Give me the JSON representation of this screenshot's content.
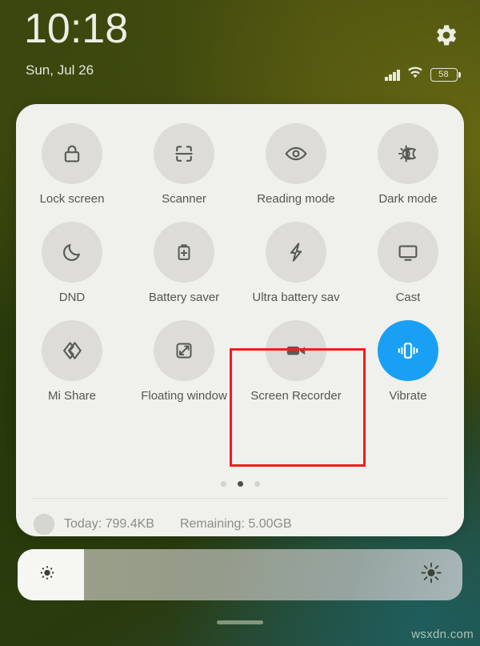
{
  "status_bar": {
    "time": "10:18",
    "date": "Sun, Jul 26",
    "battery_percent": "58",
    "settings_icon": "gear-icon",
    "signal_icon": "cellular-signal-icon",
    "wifi_icon": "wifi-icon",
    "battery_icon": "battery-icon"
  },
  "quick_settings": {
    "toggles": [
      {
        "label": "Lock screen",
        "icon": "lock-icon",
        "active": false
      },
      {
        "label": "Scanner",
        "icon": "scanner-icon",
        "active": false
      },
      {
        "label": "Reading mode",
        "icon": "eye-icon",
        "active": false
      },
      {
        "label": "Dark mode",
        "icon": "sun-moon-icon",
        "active": false
      },
      {
        "label": "DND",
        "icon": "moon-icon",
        "active": false
      },
      {
        "label": "Battery saver",
        "icon": "battery-plus-icon",
        "active": false
      },
      {
        "label": "Ultra battery sav",
        "icon": "lightning-bolt-icon",
        "active": false
      },
      {
        "label": "Cast",
        "icon": "monitor-icon",
        "active": false
      },
      {
        "label": "Mi Share",
        "icon": "mi-share-icon",
        "active": false
      },
      {
        "label": "Floating window",
        "icon": "floating-window-icon",
        "active": false
      },
      {
        "label": "Screen Recorder",
        "icon": "video-camera-icon",
        "active": false
      },
      {
        "label": "Vibrate",
        "icon": "vibrate-icon",
        "active": true
      }
    ],
    "pages": {
      "count": 3,
      "active_index": 1
    },
    "data_usage": {
      "today_label": "Today: 799.4KB",
      "remaining_label": "Remaining: 5.00GB"
    }
  },
  "brightness": {
    "level_percent": 15,
    "low_icon": "brightness-low-icon",
    "high_icon": "brightness-high-icon"
  },
  "annotation": {
    "highlight_target": "Screen Recorder",
    "highlight_color": "#f01d1d"
  },
  "colors": {
    "card_background": "#f0f0ec",
    "toggle_inactive": "#dddcd8",
    "toggle_active": "#19a0f5",
    "label_text": "#555652"
  },
  "footer": {
    "watermark": "wsxdn.com",
    "home_indicator": "home-indicator"
  }
}
